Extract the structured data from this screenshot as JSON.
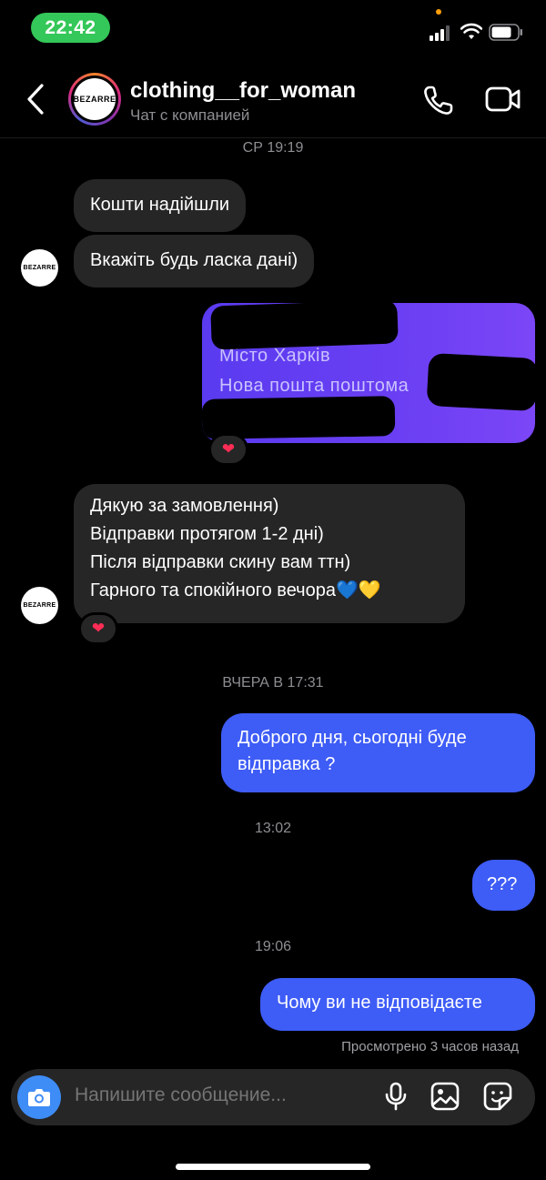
{
  "status": {
    "time": "22:42"
  },
  "header": {
    "title": "clothing__for_woman",
    "subtitle": "Чат с компанией",
    "avatar_brand": "BEZARRE"
  },
  "timestamps": {
    "t1": "СР 19:19",
    "t2": "ВЧЕРА В 17:31",
    "t3": "13:02",
    "t4": "19:06"
  },
  "messages": {
    "in1": "Кошти надійшли",
    "in2": "Вкажіть будь ласка дані)",
    "image_line1": "Місто Харків",
    "image_line2": "Нова пошта поштома",
    "in3_line1": "Дякую за замовлення)",
    "in3_line2": "Відправки протягом 1-2 дні)",
    "in3_line3": "Після відправки скину вам ттн)",
    "in3_line4": "Гарного та спокійного вечора💙💛",
    "out1_line1": "Доброго дня, сьогодні буде",
    "out1_line2": "відправка ?",
    "out2": "???",
    "out3": "Чому ви не відповідаєте",
    "seen": "Просмотрено 3 часов назад",
    "reaction": "❤"
  },
  "composer": {
    "placeholder": "Напишите сообщение..."
  },
  "colors": {
    "outgoing": "#3e5cf6",
    "incoming": "#262626",
    "status_pill": "#34c759"
  },
  "icons": [
    "back-arrow-icon",
    "phone-icon",
    "video-icon",
    "camera-icon",
    "microphone-icon",
    "gallery-icon",
    "sticker-icon",
    "heart-icon"
  ]
}
